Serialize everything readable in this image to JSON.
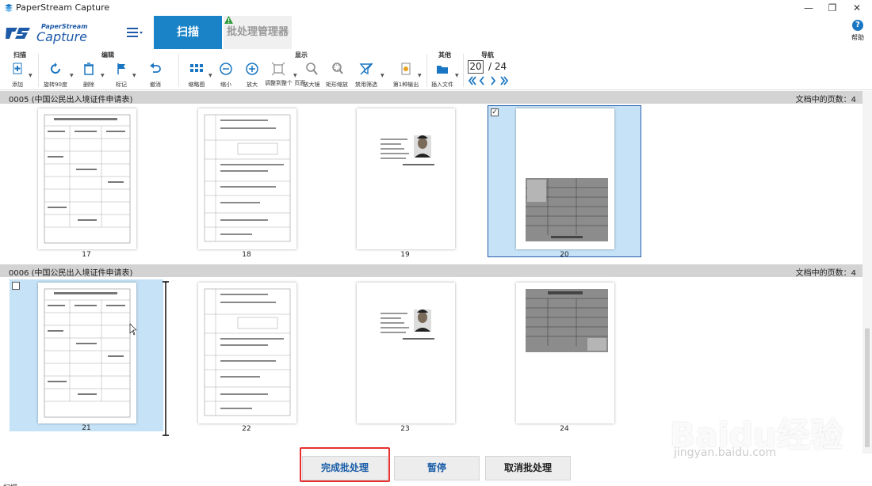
{
  "window": {
    "title": "PaperStream Capture",
    "minimize": "—",
    "restore": "❐",
    "close": "✕"
  },
  "header": {
    "logo_small": "PaperStream",
    "logo_big": "Capture",
    "tab_scan": "扫描",
    "tab_batch": "批处理管理器",
    "help_label": "帮助",
    "help_icon_text": "?"
  },
  "ribbon": {
    "groups": {
      "scan": "扫描",
      "edit": "编辑",
      "view": "显示",
      "other": "其他",
      "nav": "导航"
    },
    "buttons": {
      "add": "添加",
      "rotate": "旋转90度",
      "delete": "删除",
      "mark": "标记",
      "undo": "撤消",
      "thumbnail": "缩略图",
      "zoom_out": "缩小",
      "zoom_in": "放大",
      "fit_page": "调整到整个\n页面",
      "magnifier": "放大镜",
      "rect_zoom": "矩形缩放",
      "disable_filter": "禁用筛选",
      "single_page_out": "第1种输出",
      "insert_file": "插入文件"
    },
    "nav": {
      "current": "20",
      "total": "/ 24"
    }
  },
  "sections": [
    {
      "name": "0005 (中国公民出入境证件申请表)",
      "pages_label": "文档中的页数：4",
      "pages": [
        "17",
        "18",
        "19",
        "20"
      ]
    },
    {
      "name": "0006 (中国公民出入境证件申请表)",
      "pages_label": "文档中的页数：4",
      "pages": [
        "21",
        "22",
        "23",
        "24"
      ]
    }
  ],
  "bottom": {
    "finish": "完成批处理",
    "pause": "暂停",
    "cancel": "取消批处理"
  },
  "status": "扫描",
  "watermark": {
    "brand": "Baidu经验",
    "url": "jingyan.baidu.com"
  },
  "colors": {
    "accent": "#1a83c8",
    "selection": "#c6e2f7",
    "highlight_box": "#e53030"
  }
}
